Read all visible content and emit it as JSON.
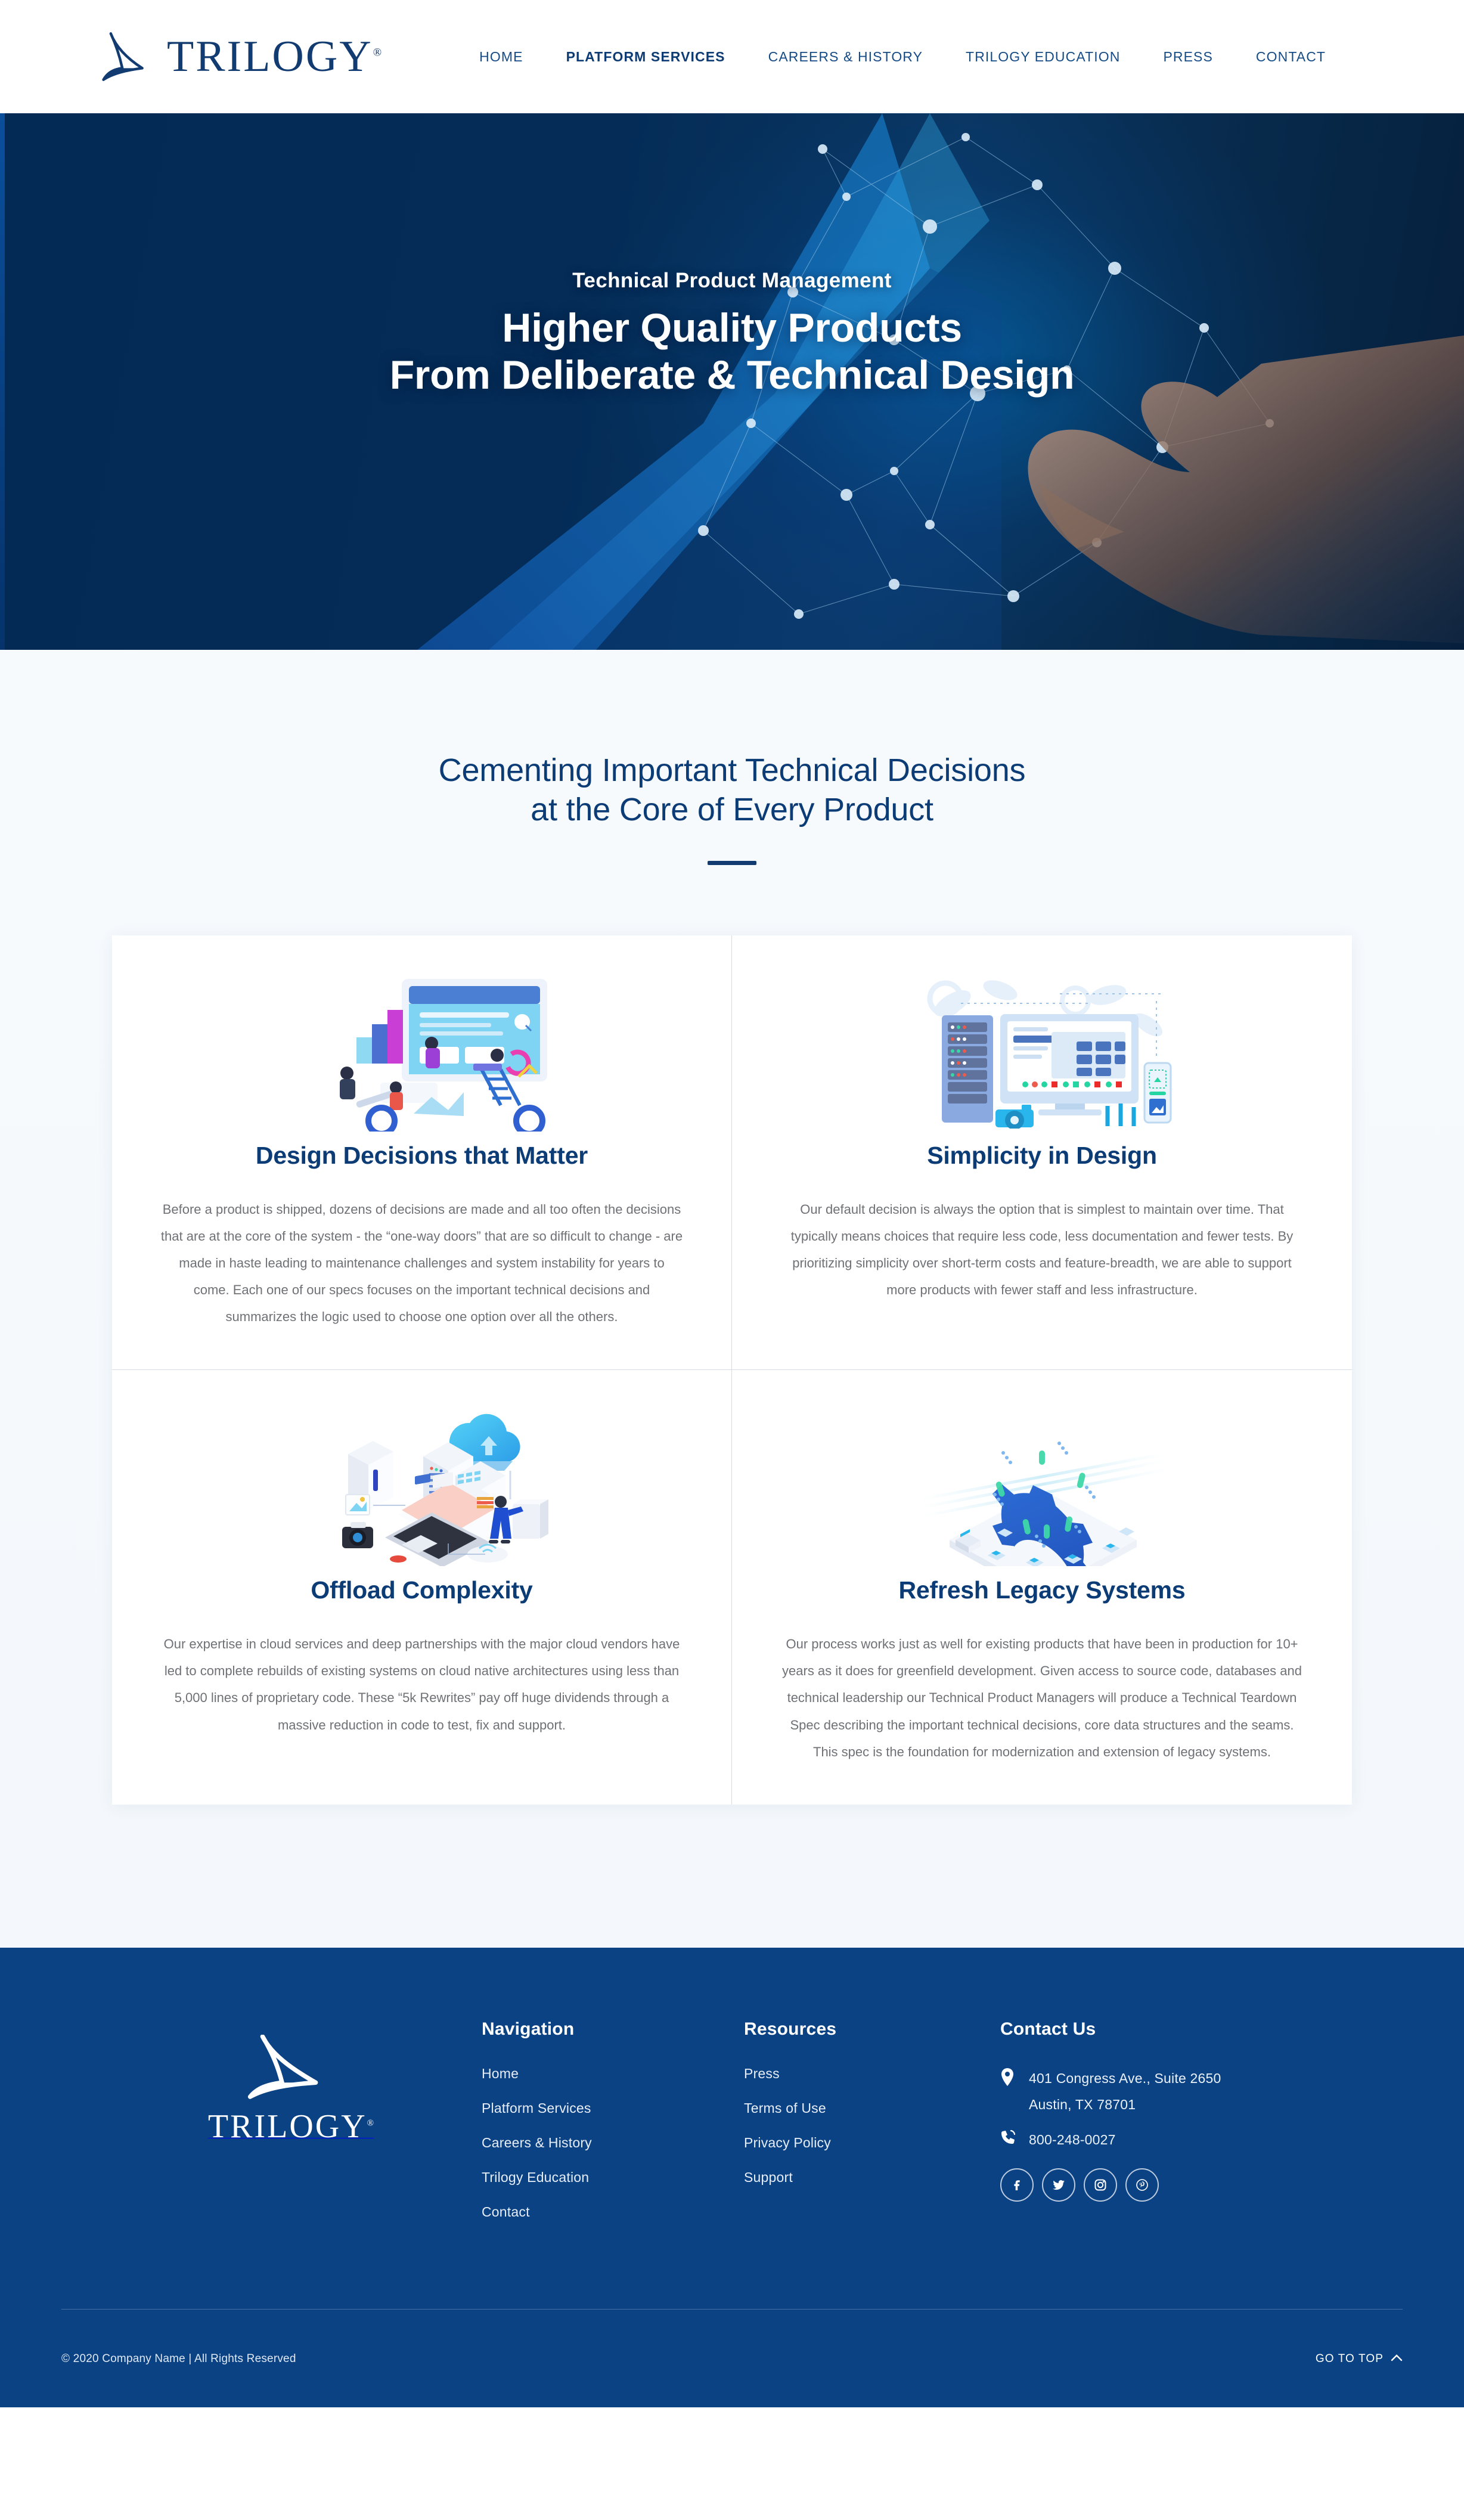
{
  "brand": {
    "name": "TRILOGY",
    "registered_mark": "®",
    "logo_icon": "trilogy-sail-triangle-logo",
    "primary_navy": "#123c71",
    "hero_navy": "#032a54",
    "footer_blue": "#0b4284",
    "body_gray": "#6f7176"
  },
  "header": {
    "nav": [
      {
        "label": "HOME",
        "active": false
      },
      {
        "label": "PLATFORM SERVICES",
        "active": true
      },
      {
        "label": "CAREERS & HISTORY",
        "active": false
      },
      {
        "label": "TRILOGY EDUCATION",
        "active": false
      },
      {
        "label": "PRESS",
        "active": false
      },
      {
        "label": "CONTACT",
        "active": false
      }
    ]
  },
  "hero": {
    "eyebrow": "Technical Product Management",
    "title_line1": "Higher Quality Products",
    "title_line2": "From Deliberate & Technical Design",
    "background_art": "network-nodes-with-hand-touching-screen"
  },
  "features": {
    "heading_line1": "Cementing Important Technical Decisions",
    "heading_line2": "at the Core of Every Product",
    "cards": [
      {
        "art": "isometric-web-design-team-illustration",
        "title": "Design Decisions that Matter",
        "body": "Before a product is shipped, dozens of decisions are made and all too often the decisions that are at the core of the system - the “one-way doors” that are so difficult to change - are made in haste leading to maintenance challenges and system instability for years to come. Each one of our specs focuses on the important technical decisions and summarizes the logic used to choose one option over all the others."
      },
      {
        "art": "flat-server-rack-and-monitor-illustration",
        "title": "Simplicity in Design",
        "body": "Our default decision is always the option that is simplest to maintain over time. That typically means choices that require less code, less documentation and fewer tests. By prioritizing simplicity over short-term costs and feature-breadth, we are able to support more products with fewer staff and less infrastructure."
      },
      {
        "art": "isometric-cloud-servers-and-laptop-illustration",
        "title": "Offload Complexity",
        "body": "Our expertise in cloud services and deep partnerships with the major cloud vendors have led to complete rebuilds of existing systems on cloud native architectures using less than 5,000 lines of proprietary code. These “5k Rewrites” pay off huge dividends through a massive reduction in code to test, fix and support."
      },
      {
        "art": "isometric-blue-gear-on-platform-illustration",
        "title": "Refresh Legacy Systems",
        "body": "Our process works just as well for existing products that have been in production for 10+ years as it does for greenfield development. Given access to source code, databases and technical leadership our Technical Product Managers will produce a Technical Teardown Spec describing the important technical decisions, core data structures and the seams. This spec is the foundation for modernization and extension of legacy systems."
      }
    ]
  },
  "footer": {
    "navigation": {
      "title": "Navigation",
      "links": [
        "Home",
        "Platform Services",
        "Careers & History",
        "Trilogy Education",
        "Contact"
      ]
    },
    "resources": {
      "title": "Resources",
      "links": [
        "Press",
        "Terms of Use",
        "Privacy Policy",
        "Support"
      ]
    },
    "contact": {
      "title": "Contact Us",
      "address_line1": "401 Congress Ave., Suite 2650",
      "address_line2": "Austin, TX 78701",
      "phone": "800-248-0027",
      "location_icon": "map-pin-icon",
      "phone_icon": "phone-ringing-icon",
      "social": [
        {
          "name": "facebook-icon",
          "glyph": "f"
        },
        {
          "name": "twitter-icon",
          "glyph": "t"
        },
        {
          "name": "instagram-icon",
          "glyph": "i"
        },
        {
          "name": "pinterest-icon",
          "glyph": "p"
        }
      ]
    },
    "copyright": "© 2020 Company Name | All Rights Reserved",
    "go_to_top": "GO TO TOP",
    "go_to_top_icon": "chevron-up-icon"
  }
}
